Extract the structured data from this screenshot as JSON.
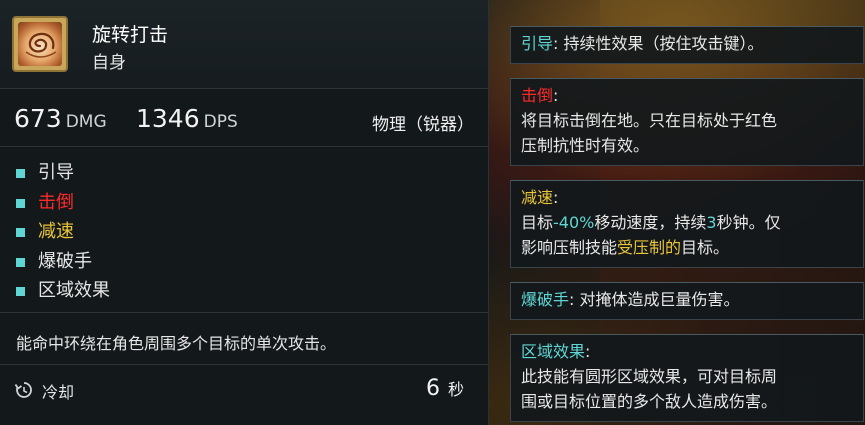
{
  "skill": {
    "name": "旋转打击",
    "target": "自身",
    "dmg_value": "673",
    "dmg_unit": "DMG",
    "dps_value": "1346",
    "dps_unit": "DPS",
    "damage_type": "物理（锐器）",
    "tags": [
      {
        "label": "引导",
        "color": "#e6e6e6"
      },
      {
        "label": "击倒",
        "color": "#ff2a2a"
      },
      {
        "label": "减速",
        "color": "#e8c53a"
      },
      {
        "label": "爆破手",
        "color": "#e6e6e6"
      },
      {
        "label": "区域效果",
        "color": "#e6e6e6"
      }
    ],
    "description": "能命中环绕在角色周围多个目标的单次攻击。",
    "cooldown_label": "冷却",
    "cooldown_value": "6",
    "cooldown_unit": "秒",
    "icon": "spiral-strike-icon"
  },
  "info_boxes": [
    {
      "keyword": "引导",
      "sep": ": ",
      "text": "持续性效果（按住攻击键）。"
    },
    {
      "keyword": "击倒",
      "sep": ":",
      "line1": "将目标击倒在地。只在目标处于红色",
      "line2": "压制抗性时有效。"
    },
    {
      "keyword": "减速",
      "sep": ":",
      "l2a": "目标",
      "l2b": "-40%",
      "l2c": "移动速度，持续",
      "l2d": "3",
      "l2e": "秒钟。仅",
      "l3a": "影响压制技能",
      "l3b": "受压制的",
      "l3c": "目标。"
    },
    {
      "keyword": "爆破手",
      "sep": ": ",
      "text": "对掩体造成巨量伤害。"
    },
    {
      "keyword": "区域效果",
      "sep": ":",
      "line1": "此技能有圆形区域效果，可对目标周",
      "line2": "围或目标位置的多个敌人造成伤害。"
    }
  ],
  "colors": {
    "cyan": "#5fd6d4",
    "red": "#ff2a2a",
    "yellow": "#e8c53a"
  }
}
